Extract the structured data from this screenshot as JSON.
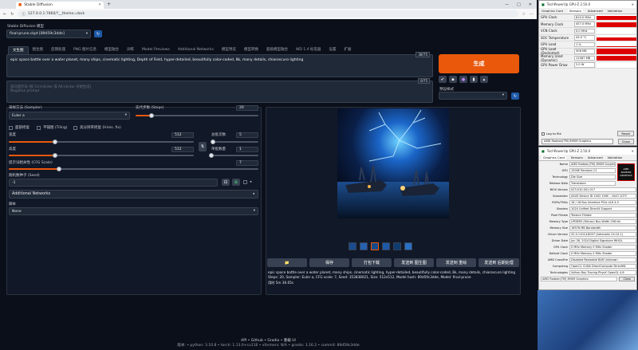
{
  "browser": {
    "tab_title": "Stable Diffusion",
    "url": "127.0.0.1:7860/?__theme=dark",
    "win_min": "—",
    "win_max": "□",
    "win_close": "✕"
  },
  "model": {
    "label": "Stable Diffusion 模型",
    "value": "final-prune.ckpt [89d59c3dde]"
  },
  "tabs": [
    "文生图",
    "图生图",
    "后期处理",
    "PNG 图片信息",
    "模型融合",
    "训练",
    "Model Previews",
    "Additional Networks",
    "模型预览",
    "模型转换",
    "超级模型融合",
    "WD 1.4 标签器",
    "设置",
    "扩展"
  ],
  "prompt": {
    "text": "epic space battle over a water planet, many ships, cinematic lighting, Depth of Field, hyper-detailed, beautifully color-coded, 8k, many details, chiaroscuro lighting",
    "count": "38/75",
    "neg_placeholder": "反向提示词 (按 Ctrl+Enter 或 Alt+Enter 开始生成)",
    "neg_sub": "Negative prompt",
    "neg_count": "0/75"
  },
  "generate_label": "生成",
  "style_label": "预设样式",
  "sampler": {
    "label": "采样方法 (Sampler)",
    "value": "Euler a"
  },
  "steps": {
    "label": "迭代步数 (Steps)",
    "value": "20",
    "frac": 0.13
  },
  "checks": {
    "restore": "面部修复",
    "tiling": "平铺图 (Tiling)",
    "hires": "高分辨率修复 (Hires. fix)"
  },
  "width": {
    "label": "宽度",
    "value": "512",
    "frac": 0.25
  },
  "height": {
    "label": "高度",
    "value": "512",
    "frac": 0.25
  },
  "batch_count": {
    "label": "总批次数",
    "value": "5",
    "frac": 0.04
  },
  "batch_size": {
    "label": "单批数量",
    "value": "1",
    "frac": 0.0
  },
  "cfg": {
    "label": "提示词相关性 (CFG Scale)",
    "value": "7",
    "frac": 0.2
  },
  "seed": {
    "label": "随机数种子 (Seed)",
    "value": "-1"
  },
  "additional_networks": "Additional Networks",
  "script": {
    "label": "脚本",
    "value": "None"
  },
  "actions": [
    "📁",
    "保存",
    "打包下载",
    "发送到 图生图",
    "发送到 重绘",
    "发送到 后期处理"
  ],
  "info": {
    "prompt": "epic space battle over a water planet, many ships, cinematic lighting, hyper-detailed, beautifully color-coded, 8k, many details, chiaroscuro lighting",
    "params": "Steps: 20, Sampler: Euler a, CFG scale: 7, Seed: 353838021, Size: 512x512, Model hash: 89d59c3dde, Model: final-prune",
    "time": "用时 5m 36.65s"
  },
  "footer": {
    "links": "API  •  Github  •  Gradio  •  重载 UI",
    "versions": "版本: • python: 3.10.8  •  torch: 1.13.0+cu116  •  xformers: N/A  •  gradio: 3.16.2  •  commit: 89d59c3dde"
  },
  "sensors": {
    "title": "TechPowerUp GPU-Z 2.50.0",
    "menu": [
      "Graphics Card",
      "Sensors",
      "Advanced",
      "Validation"
    ],
    "rows": [
      {
        "k": "GPU Clock",
        "v": "810.0 MHz",
        "level": 0.7
      },
      {
        "k": "Memory Clock",
        "v": "457.0 MHz",
        "level": 0.8
      },
      {
        "k": "VCN Clock",
        "v": "0.0 MHz",
        "level": 0.0
      },
      {
        "k": "SOC Temperature",
        "v": "43.0 °C",
        "level": 0.5
      },
      {
        "k": "GPU Load",
        "v": "1 %",
        "level": 0.2
      },
      {
        "k": "GPU Load (Dedicated)",
        "v": "308 MB",
        "level": 0.9
      },
      {
        "k": "Memory Used (Dynamic)",
        "v": "11587 MB",
        "level": 0.9
      },
      {
        "k": "GPU Power Draw",
        "v": "2.0 W",
        "level": 0.0
      }
    ],
    "log": "Log to file",
    "reset": "Reset",
    "card": "AMD Radeon(TM) 890M Graphics",
    "close": "Close"
  },
  "gpuz": {
    "title": "TechPowerUp GPU-Z 2.50.0",
    "menu": [
      "Graphics Card",
      "Sensors",
      "Advanced",
      "Validation"
    ],
    "specs": [
      {
        "k": "Name",
        "v": "AMD Radeon(TM) 890M Graphics"
      },
      {
        "k": "GPU",
        "v": "1500E      Revision    C1"
      },
      {
        "k": "Technology",
        "v": "            Die Size"
      },
      {
        "k": "Release Date",
        "v": "            Transistors"
      },
      {
        "k": "BIOS Version",
        "v": "023.010.001.017"
      },
      {
        "k": "Subvendor",
        "v": "ASUS      Device ID  1002 150E - 1043 1CF3"
      },
      {
        "k": "ROPs/TMUs",
        "v": "16 / 16      Bus Interface  PCIe x16 4.0"
      },
      {
        "k": "Shaders",
        "v": "1024 Unified    DirectX Support"
      },
      {
        "k": "Pixel Fillrate",
        "v": "            Texture Fillrate"
      },
      {
        "k": "Memory Type",
        "v": "LPDDR5 (Micron)    Bus Width  256 bit"
      },
      {
        "k": "Memory Size",
        "v": "16576 MB       Bandwidth"
      },
      {
        "k": "Driver Version",
        "v": "32.0.11014.8007 (Adrenalin 24.10.1)"
      },
      {
        "k": "Driver Date",
        "v": "Jun 26, 2024    Digital Signature  WHQL"
      },
      {
        "k": "GPU Clock",
        "v": "0 MHz    Memory  0 MHz    Shader"
      },
      {
        "k": "Default Clock",
        "v": "0 MHz    Memory  0 MHz    Shader"
      },
      {
        "k": "AMD CrossFire",
        "v": "Disabled    Resizable BAR  Unknown"
      },
      {
        "k": "Computing",
        "v": "OpenCL  CUDA  DirectCompute  DirectML"
      },
      {
        "k": "Technologies",
        "v": "Vulkan  Ray Tracing  PhysX  OpenGL 4.6"
      }
    ],
    "lookup": "Lookup",
    "brand": "AMD RADEON GRAPHICS",
    "card": "AMD Radeon(TM) 890M Graphics",
    "close": "Close"
  }
}
